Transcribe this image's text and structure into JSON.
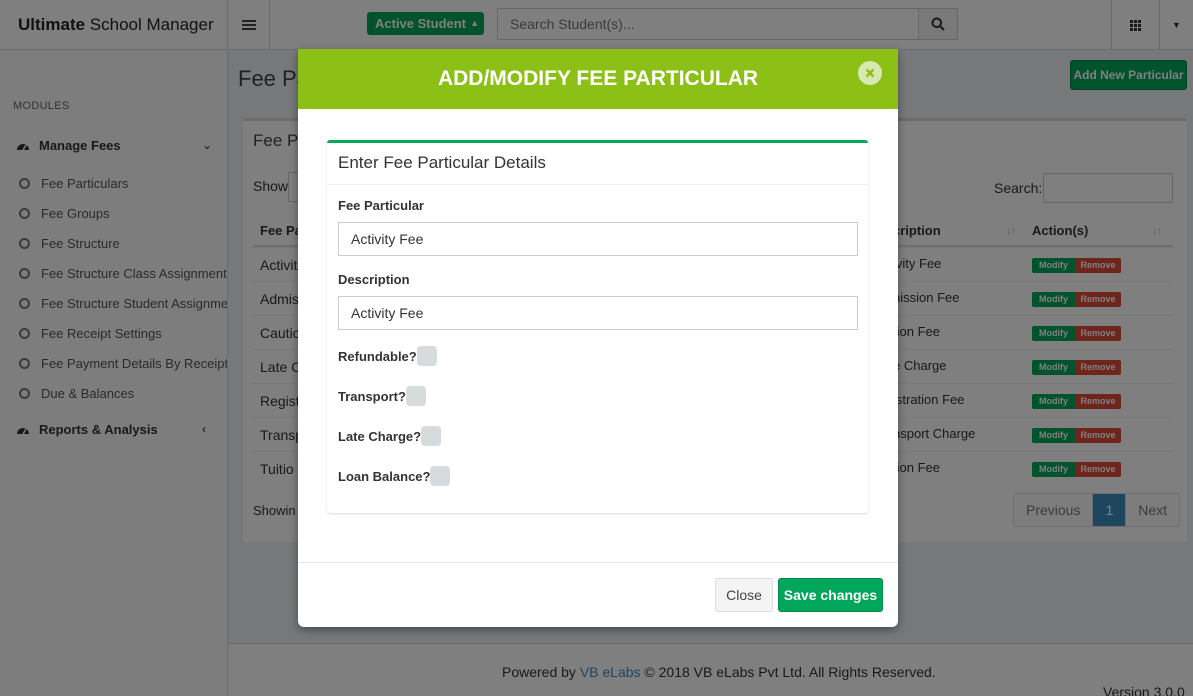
{
  "app": {
    "title_bold": "Ultimate",
    "title_rest": " School Manager"
  },
  "header": {
    "student_filter": "Active Student",
    "search_placeholder": "Search Student(s)..."
  },
  "sidebar": {
    "header": "MODULES",
    "groups": [
      {
        "label": "Manage Fees"
      },
      {
        "label": "Reports & Analysis"
      }
    ],
    "items": [
      {
        "label": "Fee Particulars"
      },
      {
        "label": "Fee Groups"
      },
      {
        "label": "Fee Structure"
      },
      {
        "label": "Fee Structure Class Assignment"
      },
      {
        "label": "Fee Structure Student Assignment"
      },
      {
        "label": "Fee Receipt Settings"
      },
      {
        "label": "Fee Payment Details By Receipt No"
      },
      {
        "label": "Due & Balances"
      }
    ]
  },
  "content": {
    "page_title": "Fee Pa",
    "add_new_label": "Add New Particular",
    "box_title": "Fee Pa",
    "show_label": "Show",
    "search_label": "Search:",
    "columns": {
      "col1": "Fee Pa",
      "col2": "cription",
      "col3": "Action(s)"
    },
    "rows": [
      {
        "name": "Activit",
        "desc": "ivity Fee"
      },
      {
        "name": "Admis",
        "desc": "nission Fee"
      },
      {
        "name": "Cautic",
        "desc": "tion Fee"
      },
      {
        "name": "Late C",
        "desc": "e Charge"
      },
      {
        "name": "Regist",
        "desc": "istration Fee"
      },
      {
        "name": "Transp",
        "desc": "nsport Charge"
      },
      {
        "name": "Tuitio",
        "desc": "tion Fee"
      }
    ],
    "modify_label": "Modify",
    "remove_label": "Remove",
    "showing": "Showin",
    "pagination": {
      "previous": "Previous",
      "current": "1",
      "next": "Next"
    }
  },
  "footer": {
    "powered_by": "Powered by ",
    "link": "VB eLabs",
    "copyright": " © 2018 VB eLabs Pvt Ltd. All Rights Reserved.",
    "version": "Version 3.0.0"
  },
  "modal": {
    "title": "ADD/MODIFY FEE PARTICULAR",
    "panel_title": "Enter Fee Particular Details",
    "fee_particular_label": "Fee Particular",
    "fee_particular_value": "Activity Fee",
    "description_label": "Description",
    "description_value": "Activity Fee",
    "checkboxes": [
      {
        "label": "Refundable?"
      },
      {
        "label": "Transport?"
      },
      {
        "label": "Late Charge?"
      },
      {
        "label": "Loan Balance?"
      }
    ],
    "close_label": "Close",
    "save_label": "Save changes"
  },
  "colors": {
    "accent_green": "#00a65a",
    "modal_header": "#8dc016",
    "danger": "#dd4b39",
    "primary": "#3c8dbc"
  }
}
